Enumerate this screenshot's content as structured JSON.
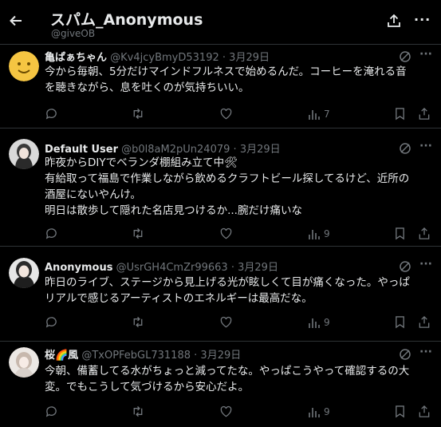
{
  "header": {
    "title": "スパム_Anonymous",
    "handle": "@giveOB"
  },
  "posts": [
    {
      "name": "亀ぱぁちゃん",
      "handle": "@Kv4jcyBmyD53192",
      "sep": "·",
      "date": "3月29日",
      "lines": [
        "今から毎朝、5分だけマインドフルネスで始めるんだ。コーヒーを淹れる音",
        "を聴きながら、息を吐くのが気持ちいい。"
      ],
      "views": "7"
    },
    {
      "name": "Default User",
      "handle": "@b0l8aM2pUn24079",
      "sep": "·",
      "date": "3月29日",
      "lines": [
        "昨夜からDIYでベランダ棚組み立て中🛠",
        "有給取って福島で作業しながら飲めるクラフトビール探してるけど、近所の",
        "酒屋にないやんけ。",
        "明日は散歩して隠れた名店見つけるか...腕だけ痛いな"
      ],
      "views": "9"
    },
    {
      "name": "Anonymous",
      "handle": "@UsrGH4CmZr99663",
      "sep": "·",
      "date": "3月29日",
      "lines": [
        "昨日のライブ、ステージから見上げる光が眩しくて目が痛くなった。やっぱ",
        "リアルで感じるアーティストのエネルギーは最高だな。"
      ],
      "views": "9"
    },
    {
      "name": "桜🌈風",
      "handle": "@TxOPFebGL731188",
      "sep": "·",
      "date": "3月29日",
      "lines": [
        "今朝、備蓄してる水がちょっと減ってたな。やっぱこうやって確認するの大",
        "変。でもこうして気づけるから安心だよ。"
      ],
      "views": "9"
    }
  ],
  "icons": {
    "back": "arrow-left-icon",
    "share": "share-icon",
    "more": "more-icon",
    "reply": "reply-icon",
    "repost": "repost-icon",
    "like": "like-icon",
    "views": "views-icon",
    "bookmark": "bookmark-icon",
    "upload": "upload-icon",
    "grok": "grok-icon"
  },
  "colors": {
    "background": "#000000",
    "text": "#e7e9ea",
    "muted": "#71767b",
    "divider": "#2f3336"
  }
}
